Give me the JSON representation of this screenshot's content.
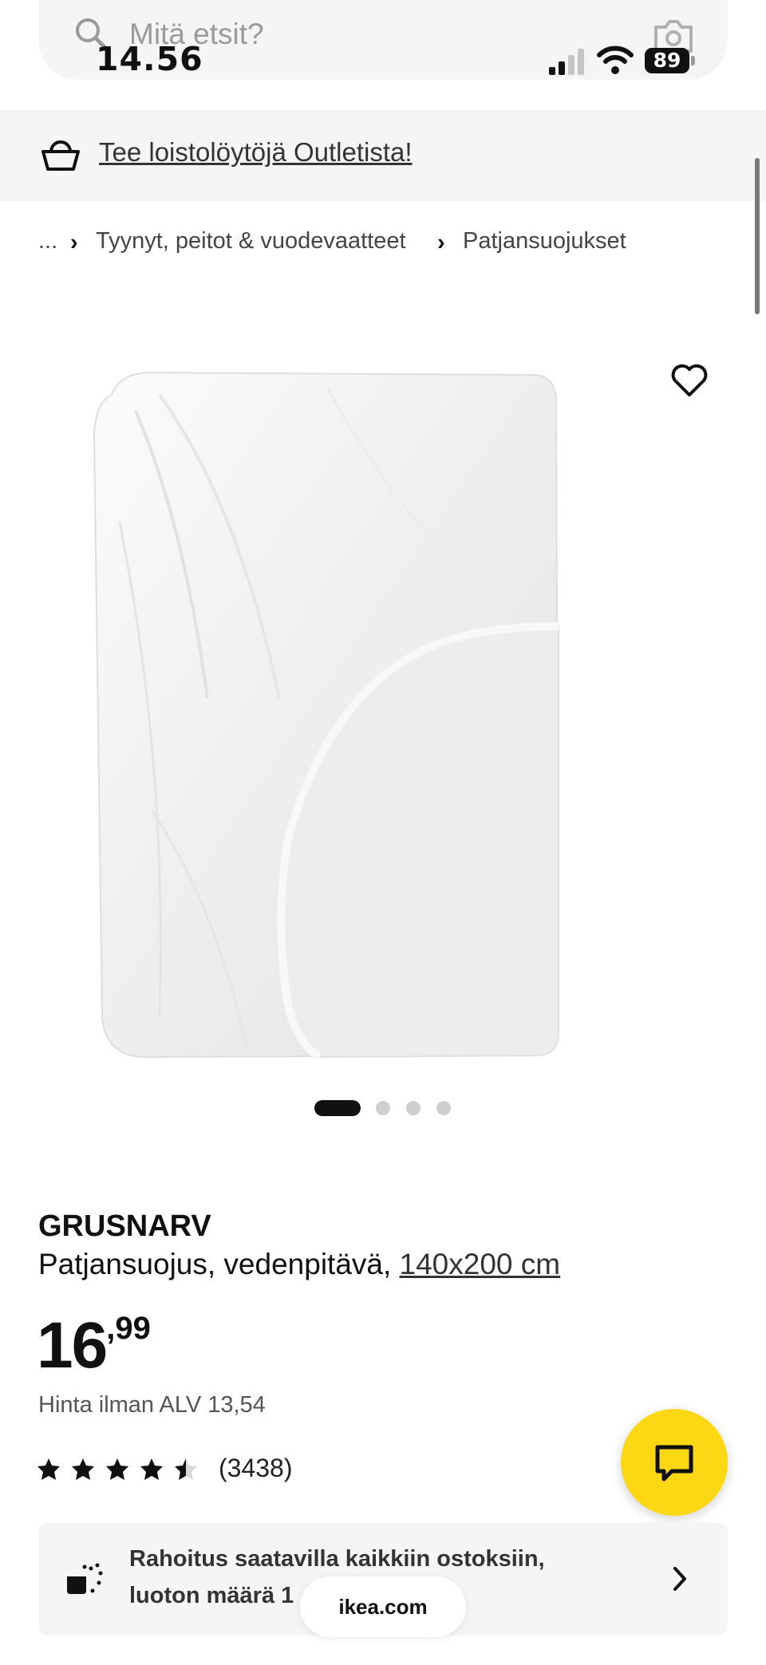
{
  "search": {
    "placeholder": "Mitä etsit?"
  },
  "status_bar": {
    "time": "14.56",
    "battery": "89"
  },
  "banner": {
    "text": "Tee loistolöytöjä Outletista!"
  },
  "breadcrumb": {
    "ellipsis": "...",
    "items": [
      "Tyynyt, peitot & vuodevaatteet",
      "Patjansuojukset"
    ]
  },
  "product": {
    "name": "GRUSNARV",
    "description": "Patjansuojus, vedenpitävä,",
    "size": "140x200 cm",
    "price_int": "16",
    "price_dec": ",99",
    "vat_text": "Hinta ilman ALV 13,54",
    "rating": 4.5,
    "review_count": "(3438)"
  },
  "carousel": {
    "total": 4,
    "active": 1
  },
  "finance": {
    "line1": "Rahoitus saatavilla kaikkiin ostoksiin,",
    "line2": "luoton määrä 1"
  },
  "browser": {
    "url": "ikea.com"
  },
  "colors": {
    "accent_yellow": "#fcd713",
    "banner_bg": "#f5f5f5",
    "text": "#111111"
  }
}
